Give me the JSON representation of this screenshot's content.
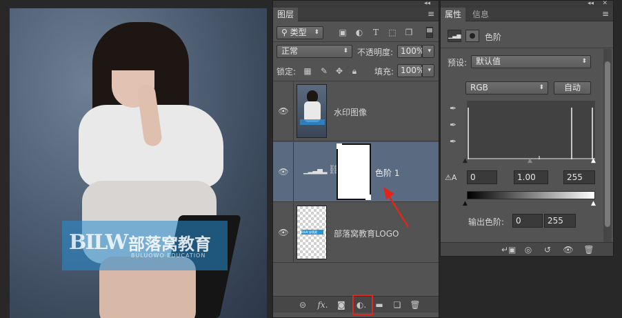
{
  "canvas": {
    "watermark_logo": "BILW",
    "watermark_cn": "部落窝教育",
    "watermark_en": "BULUOWO EDUCATION"
  },
  "layers_panel": {
    "tab": "图层",
    "collapse_glyph": "◂◂",
    "menu_glyph": "≡",
    "filter_label": "类型",
    "blend_mode": "正常",
    "opacity_label": "不透明度:",
    "opacity_value": "100%",
    "lock_label": "锁定:",
    "fill_label": "填充:",
    "fill_value": "100%",
    "layers": [
      {
        "name": "水印图像",
        "visible": true,
        "selected": false
      },
      {
        "name": "色阶 1",
        "visible": true,
        "selected": true
      },
      {
        "name": "部落窝教育LOGO",
        "visible": true,
        "selected": false
      }
    ],
    "logo_thumb_text": "BILW 部落窝"
  },
  "properties_panel": {
    "tabs": [
      "属性",
      "信息"
    ],
    "collapse_glyph": "◂◂",
    "close_glyph": "✕",
    "menu_glyph": "≡",
    "title": "色阶",
    "preset_label": "预设:",
    "preset_value": "默认值",
    "channel": "RGB",
    "auto_button": "自动",
    "input_black": "0",
    "input_gamma": "1.00",
    "input_white": "255",
    "output_label": "输出色阶:",
    "output_black": "0",
    "output_white": "255"
  },
  "colors": {
    "panel_bg": "#535353",
    "selected_layer": "#5a6a80",
    "annotation_red": "#e1251b",
    "watermark_blue": "#288cd2"
  }
}
